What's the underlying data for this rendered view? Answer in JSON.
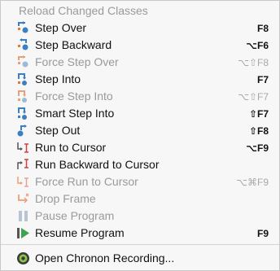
{
  "menu": {
    "header": "Reload Changed Classes",
    "items": [
      {
        "label": "Step Over",
        "shortcut": "F8",
        "disabled": false
      },
      {
        "label": "Step Backward",
        "shortcut": "⌥F6",
        "disabled": false
      },
      {
        "label": "Force Step Over",
        "shortcut": "⌥⇧F8",
        "disabled": true
      },
      {
        "label": "Step Into",
        "shortcut": "F7",
        "disabled": false
      },
      {
        "label": "Force Step Into",
        "shortcut": "⌥⇧F7",
        "disabled": true
      },
      {
        "label": "Smart Step Into",
        "shortcut": "⇧F7",
        "disabled": false
      },
      {
        "label": "Step Out",
        "shortcut": "⇧F8",
        "disabled": false
      },
      {
        "label": "Run to Cursor",
        "shortcut": "⌥F9",
        "disabled": false
      },
      {
        "label": "Run Backward to Cursor",
        "shortcut": "",
        "disabled": false
      },
      {
        "label": "Force Run to Cursor",
        "shortcut": "⌥⌘F9",
        "disabled": true
      },
      {
        "label": "Drop Frame",
        "shortcut": "",
        "disabled": true
      },
      {
        "label": "Pause Program",
        "shortcut": "",
        "disabled": true
      },
      {
        "label": "Resume Program",
        "shortcut": "F9",
        "disabled": false
      },
      {
        "label": "Open Chronon Recording...",
        "shortcut": "",
        "disabled": false
      }
    ]
  },
  "colors": {
    "blue": "#3b7fc4",
    "orange": "#e07b39",
    "green": "#3fa34d",
    "gray": "#b7c4d1"
  }
}
